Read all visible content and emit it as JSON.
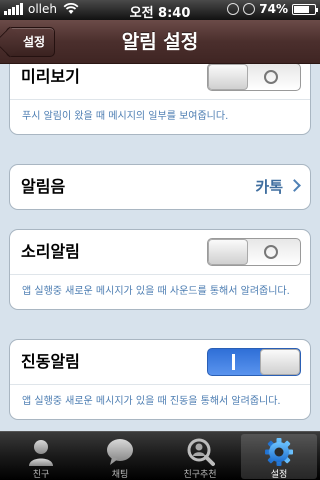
{
  "status_bar": {
    "carrier": "olleh",
    "time": "오전 8:40",
    "battery": "74%",
    "battery_level": 0.74
  },
  "nav": {
    "back_label": "설정",
    "title": "알림 설정"
  },
  "settings": {
    "preview": {
      "label": "미리보기",
      "toggle_on": false,
      "description": "푸시 알림이 왔을 때 메시지의 일부를 보여줍니다."
    },
    "ringtone": {
      "label": "알림음",
      "value": "카톡"
    },
    "sound_alert": {
      "label": "소리알림",
      "toggle_on": false,
      "description": "앱 실행중 새로운 메시지가 있을 때 사운드를 통해서 알려줍니다."
    },
    "vibration_alert": {
      "label": "진동알림",
      "toggle_on": true,
      "description": "앱 실행중 새로운 메시지가 있을 때 진동을 통해서 알려줍니다."
    }
  },
  "tabs": [
    {
      "label": "친구",
      "icon": "person-icon",
      "active": false
    },
    {
      "label": "채팅",
      "icon": "speech-bubble-icon",
      "active": false
    },
    {
      "label": "친구추천",
      "icon": "search-person-icon",
      "active": false
    },
    {
      "label": "설정",
      "icon": "gear-icon",
      "active": true
    }
  ],
  "colors": {
    "nav_bar": "#4b2f2d",
    "background": "#d7e2ec",
    "description_text": "#4c7db2",
    "toggle_on": "#2f6fd7",
    "active_tab_icon": "#2f8fe0"
  }
}
